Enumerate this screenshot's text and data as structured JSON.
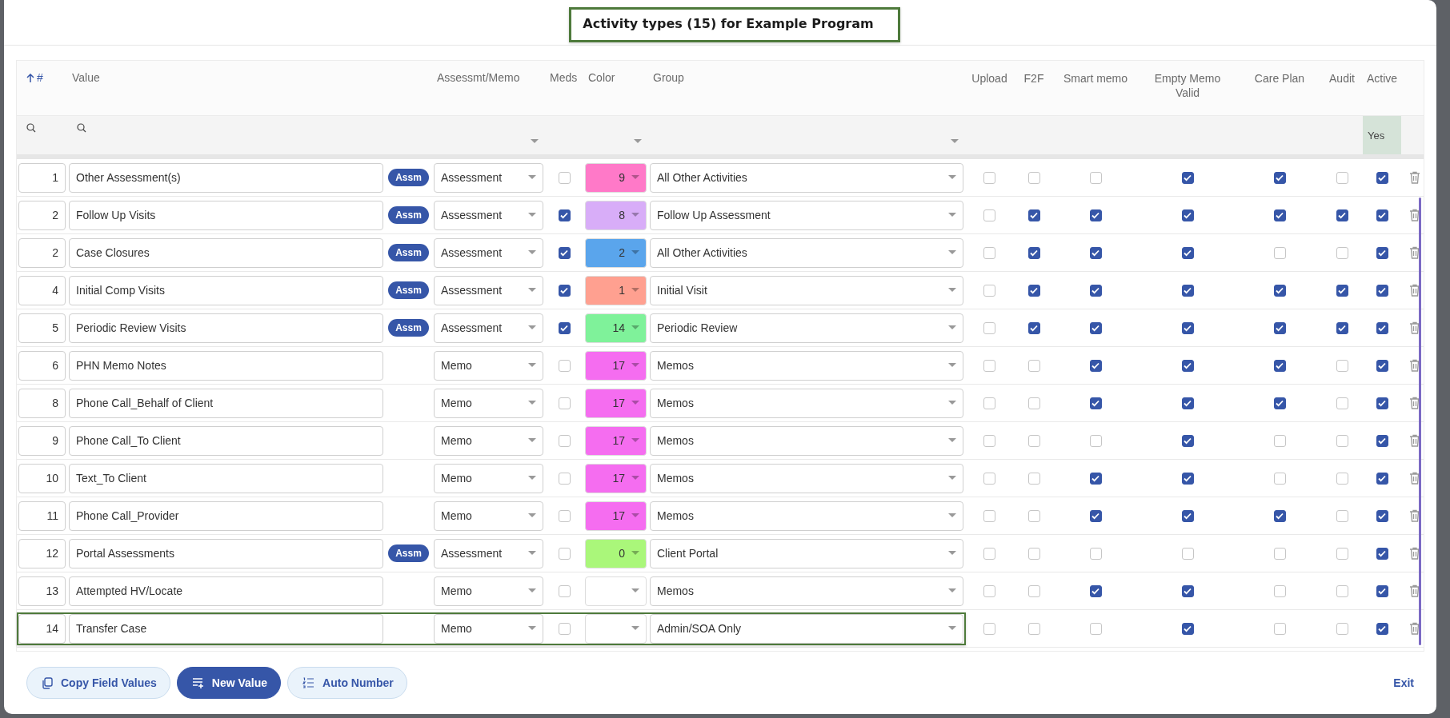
{
  "title": "Activity types (15) for Example Program",
  "columns": [
    {
      "label": "#",
      "sorted": true
    },
    {
      "label": "Value",
      "sorted": false
    },
    {
      "label": "Assessmt/Memo",
      "sorted": false
    },
    {
      "label": "Meds",
      "sorted": false
    },
    {
      "label": "Color",
      "sorted": false
    },
    {
      "label": "Group",
      "sorted": false
    },
    {
      "label": "Upload",
      "sorted": false
    },
    {
      "label": "F2F",
      "sorted": false
    },
    {
      "label": "Smart memo",
      "sorted": false
    },
    {
      "label": "Empty Memo Valid",
      "sorted": false
    },
    {
      "label": "Care Plan",
      "sorted": false
    },
    {
      "label": "Audit",
      "sorted": false
    },
    {
      "label": "Active",
      "sorted": false
    }
  ],
  "active_filter": "Yes",
  "rows": [
    {
      "number": "1",
      "value": "Other Assessment(s)",
      "badge": "Assm",
      "type": "Assessment",
      "meds": false,
      "color": "#ff79c8",
      "color_value": "9",
      "group": "All Other Activities",
      "upload": false,
      "f2f": false,
      "smart_memo": false,
      "empty_memo_valid": true,
      "care_plan": true,
      "audit": false,
      "active": true,
      "highlighted": false
    },
    {
      "number": "2",
      "value": "Follow Up Visits",
      "badge": "Assm",
      "type": "Assessment",
      "meds": true,
      "color": "#d8adf8",
      "color_value": "8",
      "group": "Follow Up Assessment",
      "upload": false,
      "f2f": true,
      "smart_memo": true,
      "empty_memo_valid": true,
      "care_plan": true,
      "audit": true,
      "active": true,
      "highlighted": false
    },
    {
      "number": "2",
      "value": "Case Closures",
      "badge": "Assm",
      "type": "Assessment",
      "meds": true,
      "color": "#5aa5ec",
      "color_value": "2",
      "group": "All Other Activities",
      "upload": false,
      "f2f": true,
      "smart_memo": true,
      "empty_memo_valid": true,
      "care_plan": false,
      "audit": false,
      "active": true,
      "highlighted": false
    },
    {
      "number": "4",
      "value": "Initial Comp Visits",
      "badge": "Assm",
      "type": "Assessment",
      "meds": true,
      "color": "#ffa090",
      "color_value": "1",
      "group": "Initial Visit",
      "upload": false,
      "f2f": true,
      "smart_memo": true,
      "empty_memo_valid": true,
      "care_plan": true,
      "audit": true,
      "active": true,
      "highlighted": false
    },
    {
      "number": "5",
      "value": "Periodic Review Visits",
      "badge": "Assm",
      "type": "Assessment",
      "meds": true,
      "color": "#7ff29a",
      "color_value": "14",
      "group": "Periodic Review",
      "upload": false,
      "f2f": true,
      "smart_memo": true,
      "empty_memo_valid": true,
      "care_plan": true,
      "audit": true,
      "active": true,
      "highlighted": false
    },
    {
      "number": "6",
      "value": "PHN Memo Notes",
      "type": "Memo",
      "meds": false,
      "color": "#f56df0",
      "color_value": "17",
      "group": "Memos",
      "upload": false,
      "f2f": false,
      "smart_memo": true,
      "empty_memo_valid": true,
      "care_plan": true,
      "audit": false,
      "active": true,
      "highlighted": false
    },
    {
      "number": "8",
      "value": "Phone Call_Behalf of Client",
      "type": "Memo",
      "meds": false,
      "color": "#f56df0",
      "color_value": "17",
      "group": "Memos",
      "upload": false,
      "f2f": false,
      "smart_memo": true,
      "empty_memo_valid": true,
      "care_plan": true,
      "audit": false,
      "active": true,
      "highlighted": false
    },
    {
      "number": "9",
      "value": "Phone Call_To Client",
      "type": "Memo",
      "meds": false,
      "color": "#f56df0",
      "color_value": "17",
      "group": "Memos",
      "upload": false,
      "f2f": false,
      "smart_memo": false,
      "empty_memo_valid": true,
      "care_plan": false,
      "audit": false,
      "active": true,
      "highlighted": false
    },
    {
      "number": "10",
      "value": "Text_To Client",
      "type": "Memo",
      "meds": false,
      "color": "#f56df0",
      "color_value": "17",
      "group": "Memos",
      "upload": false,
      "f2f": false,
      "smart_memo": true,
      "empty_memo_valid": true,
      "care_plan": false,
      "audit": false,
      "active": true,
      "highlighted": false
    },
    {
      "number": "11",
      "value": "Phone Call_Provider",
      "type": "Memo",
      "meds": false,
      "color": "#f56df0",
      "color_value": "17",
      "group": "Memos",
      "upload": false,
      "f2f": false,
      "smart_memo": true,
      "empty_memo_valid": true,
      "care_plan": true,
      "audit": false,
      "active": true,
      "highlighted": false
    },
    {
      "number": "12",
      "value": "Portal Assessments",
      "badge": "Assm",
      "type": "Assessment",
      "meds": false,
      "color": "#aaf77a",
      "color_value": "0",
      "group": "Client Portal",
      "upload": false,
      "f2f": false,
      "smart_memo": false,
      "empty_memo_valid": false,
      "care_plan": false,
      "audit": false,
      "active": true,
      "highlighted": false
    },
    {
      "number": "13",
      "value": "Attempted HV/Locate",
      "type": "Memo",
      "meds": false,
      "group": "Memos",
      "upload": false,
      "f2f": false,
      "smart_memo": true,
      "empty_memo_valid": true,
      "care_plan": false,
      "audit": false,
      "active": true,
      "highlighted": false
    },
    {
      "number": "14",
      "value": "Transfer Case",
      "type": "Memo",
      "meds": false,
      "group": "Admin/SOA Only",
      "upload": false,
      "f2f": false,
      "smart_memo": false,
      "empty_memo_valid": true,
      "care_plan": false,
      "audit": false,
      "active": true,
      "highlighted": true
    }
  ],
  "buttons": [
    {
      "label": "Copy Field Values",
      "kind": "secondary"
    },
    {
      "label": "New Value",
      "kind": "primary"
    },
    {
      "label": "Auto Number",
      "kind": "secondary"
    }
  ],
  "exit": "Exit"
}
